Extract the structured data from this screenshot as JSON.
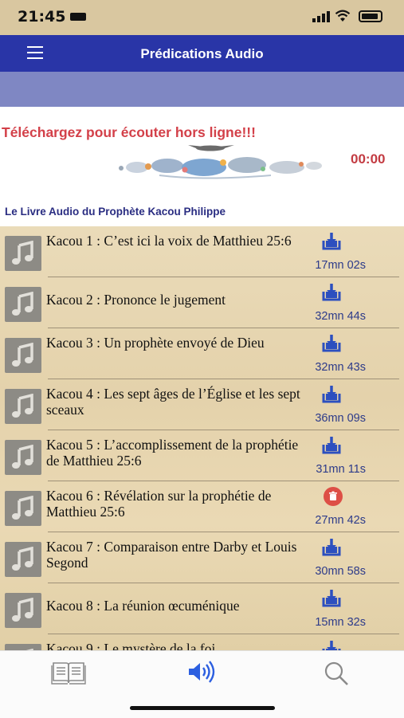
{
  "status_bar": {
    "time": "21:45"
  },
  "header": {
    "title": "Prédications Audio"
  },
  "promo": {
    "text": "Téléchargez pour écouter hors ligne!!!",
    "timer": "00:00"
  },
  "section_title": "Le Livre Audio du Prophète Kacou Philippe",
  "sermons": [
    {
      "title": "Kacou 1 : C’est ici la voix de Matthieu 25:6",
      "duration": "17mn 02s",
      "state": "download"
    },
    {
      "title": "Kacou 2 : Prononce le jugement",
      "duration": "32mn 44s",
      "state": "download"
    },
    {
      "title": "Kacou 3 : Un prophète envoyé de Dieu",
      "duration": "32mn 43s",
      "state": "download"
    },
    {
      "title": "Kacou 4 : Les sept âges de l’Église et les sept sceaux",
      "duration": "36mn 09s",
      "state": "download"
    },
    {
      "title": "Kacou 5 : L’accomplissement de la prophétie de Matthieu 25:6",
      "duration": "31mn 11s",
      "state": "download"
    },
    {
      "title": "Kacou 6 : Révélation sur la prophétie de Matthieu 25:6",
      "duration": "27mn 42s",
      "state": "delete"
    },
    {
      "title": "Kacou 7 : Comparaison entre Darby et Louis Segond",
      "duration": "30mn 58s",
      "state": "download"
    },
    {
      "title": "Kacou 8 : La réunion œcuménique",
      "duration": "15mn 32s",
      "state": "download"
    },
    {
      "title": "Kacou 9 : Le mystère de la foi",
      "duration": "",
      "state": "download"
    }
  ],
  "colors": {
    "navbar": "#2935a7",
    "subbar": "#7f87c3",
    "promo_text": "#d34049",
    "section_title": "#2a2d82",
    "duration": "#2d3b8a",
    "download_icon": "#2c4fbf",
    "delete_icon": "#dd4f46"
  },
  "tabs": [
    {
      "name": "book-icon"
    },
    {
      "name": "speaker-icon",
      "active": true
    },
    {
      "name": "search-icon"
    }
  ]
}
